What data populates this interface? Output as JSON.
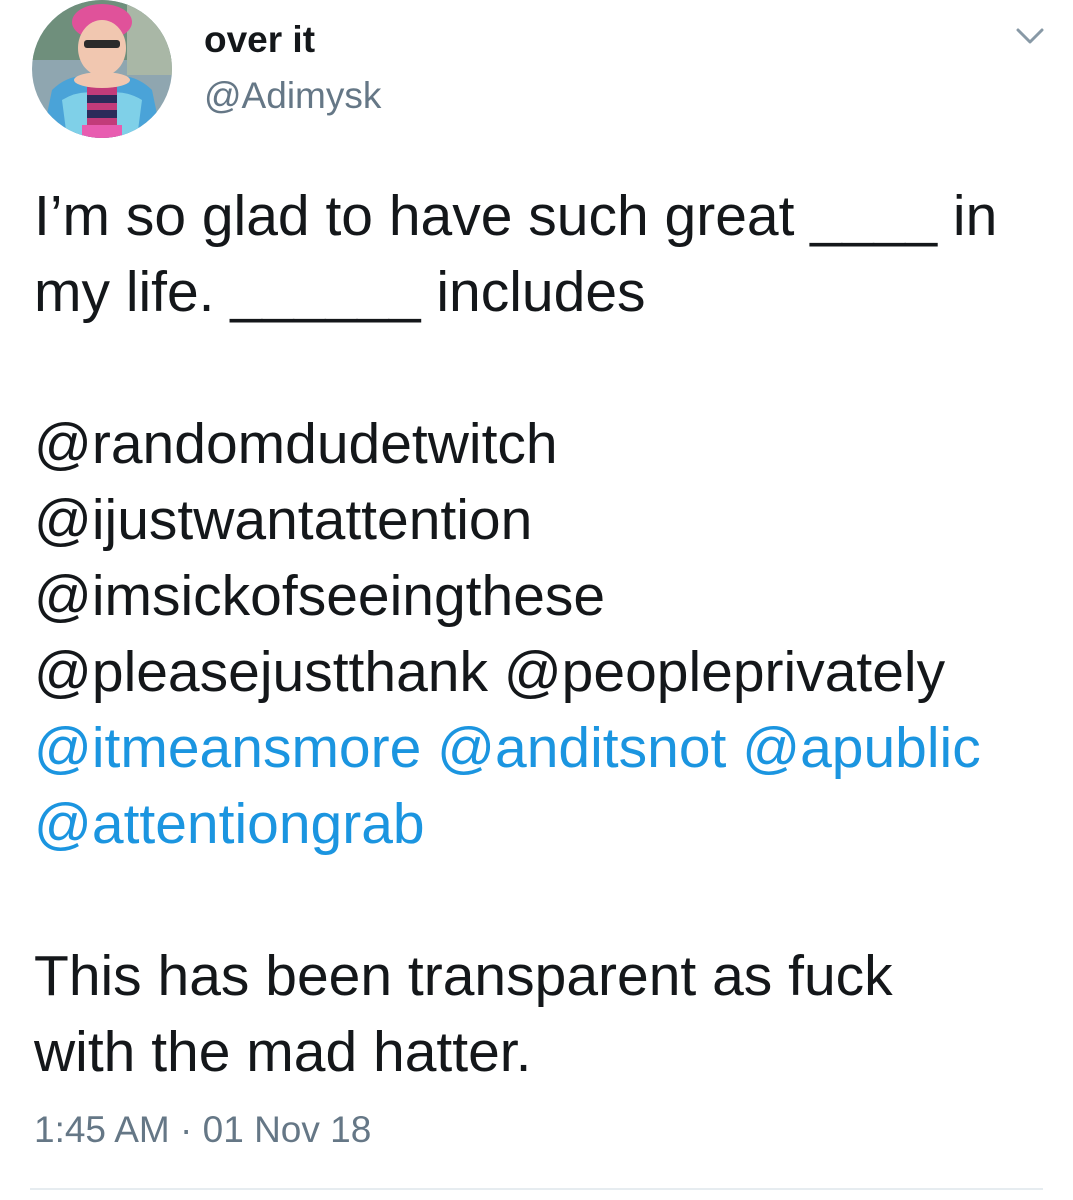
{
  "tweet": {
    "author": {
      "display_name": "over it",
      "handle": "@Adimysk",
      "avatar_icon": "profile-photo"
    },
    "menu_icon": "chevron-down-icon",
    "text": {
      "line1": "I’m so glad to have such great ____ in",
      "line2": "my life. ______ includes",
      "mentions": {
        "line1": "@randomdudetwitch",
        "line2": "@ijustwantattention",
        "line3": "@imsickofseeingthese",
        "line4a": "@pleasejustthank",
        "line4b": "@peopleprivately",
        "line5a": "@itmeansmore",
        "line5b": "@anditsnot",
        "line5c": "@apublic",
        "line6": "@attentiongrab"
      },
      "closing1": "This has been transparent as fuck",
      "closing2": "with the mad hatter."
    },
    "timestamp": {
      "time": "1:45 AM",
      "separator": "·",
      "date": "01 Nov 18"
    },
    "colors": {
      "text": "#14171a",
      "secondary": "#657786",
      "link": "#1b95e0",
      "divider": "#e6ecf0"
    }
  }
}
